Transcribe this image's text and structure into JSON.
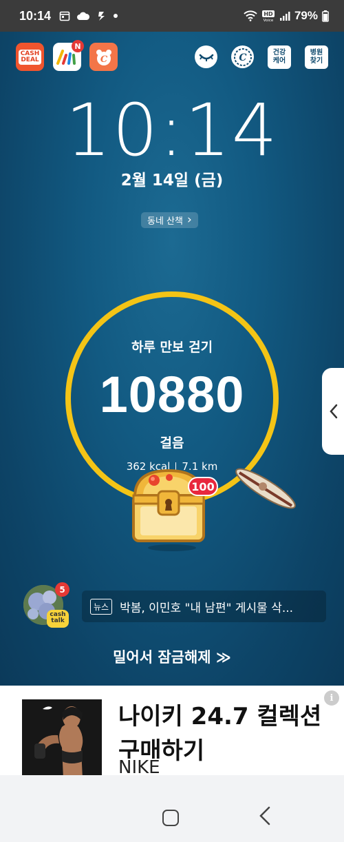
{
  "status_bar": {
    "time": "10:14",
    "battery_pct": "79%",
    "icons_left": [
      "calendar-icon",
      "cloud-icon",
      "sync-icon",
      "dot"
    ],
    "icons_right": [
      "wifi-icon",
      "hd-voice-icon",
      "signal-icon",
      "battery-icon"
    ]
  },
  "top_apps": {
    "cash_deal_label_1": "CASH",
    "cash_deal_label_2": "DEAL",
    "stripes_badge": "N",
    "health_care_label": "건강\n케어",
    "hospital_label": "병원\n찾기"
  },
  "lockscreen": {
    "clock": "10:14",
    "date": "2월 14일 (금)",
    "walk_chip": "동네 산책",
    "walk_chip_arrow": "›"
  },
  "pedometer": {
    "title": "하루 만보 걷기",
    "steps": "10880",
    "unit": "걸음",
    "kcal": "362 kcal",
    "distance": "7.1 km",
    "reward_badge": "100"
  },
  "news": {
    "avatar_badge": "5",
    "cashtalk_1": "cash",
    "cashtalk_2": "talk",
    "tag": "뉴스",
    "headline": "박봄, 이민호 \"내 남편\" 게시물 삭..."
  },
  "unlock_text": "밀어서 잠금해제 ≫",
  "ad": {
    "title": "나이키 24.7 컬렉션",
    "title_line2": "구매하기",
    "brand": "NIKE",
    "info_icon": "i"
  },
  "colors": {
    "ring": "#f4c416",
    "background": "#0f4a6e",
    "badge_red": "#e8273d"
  }
}
